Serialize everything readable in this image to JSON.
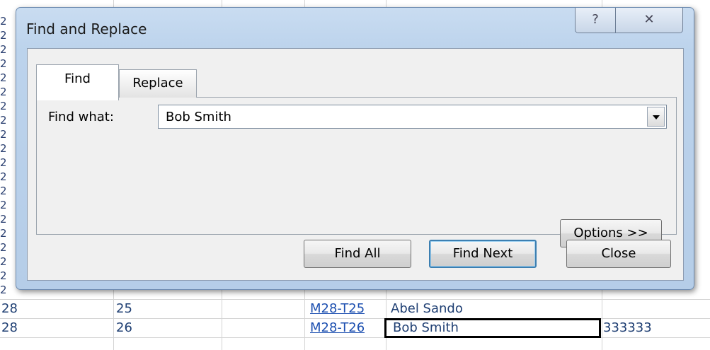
{
  "dialog": {
    "title": "Find and Replace",
    "help_icon": "question-mark-icon",
    "close_icon": "close-x-icon",
    "help_glyph": "?",
    "close_glyph": "✕",
    "tabs": [
      {
        "label": "Find",
        "active": true
      },
      {
        "label": "Replace",
        "active": false
      }
    ],
    "find_what_label": "Find what:",
    "find_what_value": "Bob Smith",
    "buttons": {
      "options": "Options >>",
      "find_all": "Find All",
      "find_next": "Find Next",
      "close": "Close"
    }
  },
  "sheet": {
    "rows": [
      {
        "a": "28",
        "b": "25",
        "d": "M28-T25",
        "e": "Abel Sando",
        "f": ""
      },
      {
        "a": "28",
        "b": "26",
        "d": "M28-T26",
        "e": "Bob Smith",
        "f": "333333"
      }
    ],
    "left_strip_numbers": [
      "2",
      "2",
      "2",
      "2",
      "2",
      "2",
      "2",
      "2",
      "2",
      "2",
      "2",
      "2",
      "2",
      "2",
      "2",
      "2",
      "2",
      "2",
      "2",
      "2"
    ]
  },
  "colors": {
    "dialog_frame": "#bcd3ec",
    "link": "#1c4fb0",
    "default_button_border": "#3c7fb1"
  }
}
